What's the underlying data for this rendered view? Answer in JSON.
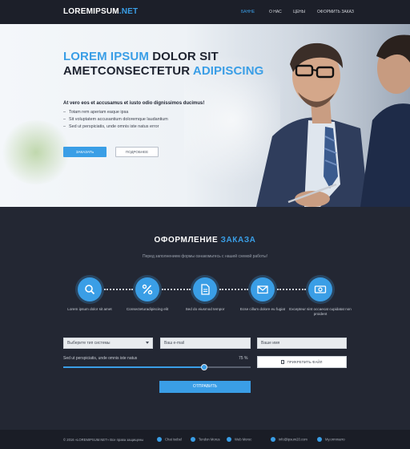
{
  "header": {
    "logo_part1": "LOREMIPSUM",
    "logo_part2": ".NET",
    "nav": [
      "БАННЕ",
      "О НАС",
      "ЦЕНЫ",
      "ОФОРМИТЬ ЗАКАЗ"
    ],
    "active_nav": "БАННЕ"
  },
  "hero": {
    "title_line1_blue": "LOREM IPSUM",
    "title_line1_dark": " DOLOR SIT",
    "title_line2_dark": "AMETCONSECTETUR ",
    "title_line2_blue": "ADIPISCING",
    "subtitle": "At vero eos et accusamus et iusto odio dignissimos ducimus!",
    "bullets": [
      "Totam rem aperiam eaque ipsa",
      "Sit voluptatem accusantium doloremque laudantium",
      "Sed ut perspiciatis, unde omnis iste natus error"
    ],
    "btn_order": "ЗАКАЗАТЬ",
    "btn_more": "ПОДРОБНЕЕ"
  },
  "order": {
    "title_white": "ОФОРМЛЕНИЕ",
    "title_blue": "ЗАКАЗА",
    "subtitle": "Перед заполнением формы ознакомьтесь с нашей схемой работы!",
    "steps": [
      {
        "icon": "search-icon",
        "label": "Lorem ipsum dolor sit amet"
      },
      {
        "icon": "percent-icon",
        "label": "Consecteturadipiscing elit"
      },
      {
        "icon": "document-icon",
        "label": "Sed do eiusmod tempor"
      },
      {
        "icon": "mail-icon",
        "label": "Ecse cillum dolore eu fugiat"
      },
      {
        "icon": "money-icon",
        "label": "Excepteur sint occaecat cupidatat non proident"
      }
    ]
  },
  "form": {
    "system_select": "Выберите тип системы",
    "email_placeholder": "Ваш e-mail",
    "name_placeholder": "Ваше имя",
    "range_label": "Sed ut perspiciatis, unde omnis iste natus",
    "range_value_text": "75 %",
    "range_value": 0.75,
    "attach_label": "ПРИКРЕПИТЬ ФАЙЛ",
    "submit_label": "ОТПРАВИТЬ"
  },
  "footer": {
    "copyright": "© 2016 «LOREMIPSUM.NET» Все права защищены",
    "items": [
      {
        "icon": "location-icon",
        "label": "Chat isobel"
      },
      {
        "icon": "phone-icon",
        "label": "Tendon Morus"
      },
      {
        "icon": "web-icon",
        "label": "Web Moroc"
      },
      {
        "icon": "mail-icon",
        "label": "info@ipsum20.com"
      },
      {
        "icon": "skype-icon",
        "label": "My.ormmarro"
      }
    ]
  },
  "colors": {
    "accent": "#3a9ee6",
    "dark_bg": "#232733",
    "header_bg": "#1c1f29"
  }
}
